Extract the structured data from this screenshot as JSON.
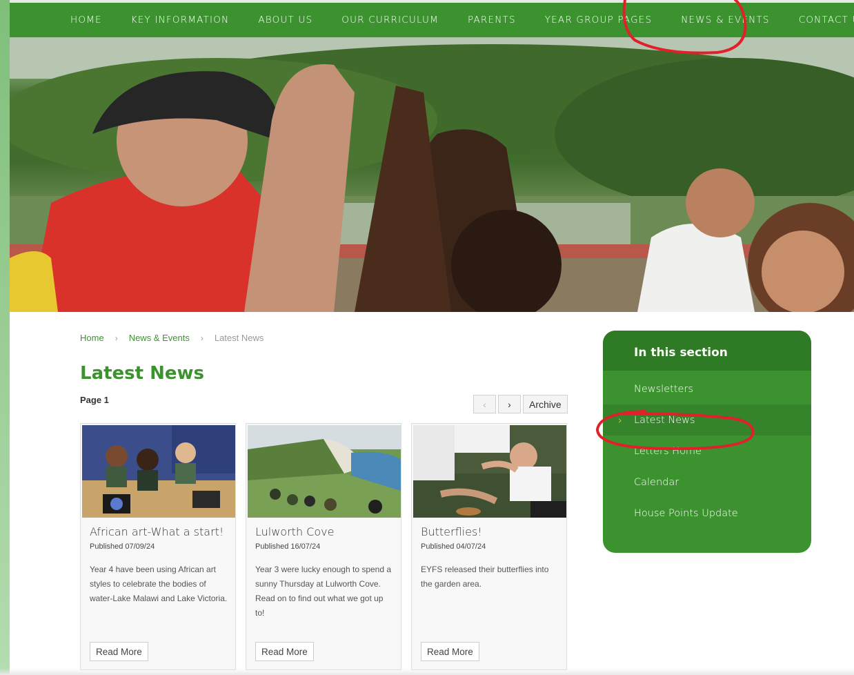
{
  "nav": {
    "items": [
      "HOME",
      "KEY INFORMATION",
      "ABOUT US",
      "OUR CURRICULUM",
      "PARENTS",
      "YEAR GROUP PAGES",
      "NEWS & EVENTS",
      "CONTACT US"
    ]
  },
  "breadcrumb": {
    "home": "Home",
    "section": "News & Events",
    "current": "Latest News",
    "separator": "›"
  },
  "page": {
    "title": "Latest News",
    "page_label": "Page 1"
  },
  "pager": {
    "prev": "‹",
    "next": "›",
    "archive": "Archive"
  },
  "articles": [
    {
      "title": "African art-What a start!",
      "date": "Published 07/09/24",
      "summary": "Year 4 have been using African art styles to celebrate the bodies of water-Lake Malawi and Lake Victoria.",
      "button": "Read More"
    },
    {
      "title": "Lulworth Cove",
      "date": "Published 16/07/24",
      "summary": "Year 3 were lucky enough to spend a sunny Thursday at Lulworth Cove. Read on to find out what we got up to!",
      "button": "Read More"
    },
    {
      "title": "Butterflies!",
      "date": "Published 04/07/24",
      "summary": "EYFS released their butterflies into the garden area.",
      "button": "Read More"
    }
  ],
  "sidebar": {
    "heading": "In this section",
    "items": [
      "Newsletters",
      "Latest News",
      "Letters Home",
      "Calendar",
      "House Points Update"
    ],
    "chevron": "›"
  },
  "colors": {
    "brand_green": "#3d9230",
    "dark_green": "#2f7a25",
    "annotation_red": "#e0202a",
    "chevron_yellow": "#f3d34a"
  }
}
